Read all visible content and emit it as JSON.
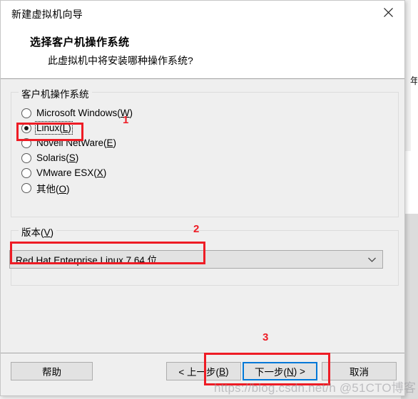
{
  "window": {
    "title": "新建虚拟机向导",
    "close_icon": "close-icon"
  },
  "header": {
    "title": "选择客户机操作系统",
    "subtitle": "此虚拟机中将安装哪种操作系统?"
  },
  "guest_os_group": {
    "legend_prefix": "客户机操作系统",
    "options": [
      {
        "label": "Microsoft Windows(W)",
        "text": "Microsoft Windows(",
        "accel": "W",
        "suffix": ")",
        "selected": false
      },
      {
        "label": "Linux(L)",
        "text": "Linux(",
        "accel": "L",
        "suffix": ")",
        "selected": true
      },
      {
        "label": "Novell NetWare(E)",
        "text": "Novell NetWare(",
        "accel": "E",
        "suffix": ")",
        "selected": false
      },
      {
        "label": "Solaris(S)",
        "text": "Solaris(",
        "accel": "S",
        "suffix": ")",
        "selected": false
      },
      {
        "label": "VMware ESX(X)",
        "text": "VMware ESX(",
        "accel": "X",
        "suffix": ")",
        "selected": false
      },
      {
        "label": "其他(O)",
        "text": "其他(",
        "accel": "O",
        "suffix": ")",
        "selected": false
      }
    ]
  },
  "version_group": {
    "legend_text": "版本(",
    "legend_accel": "V",
    "legend_suffix": ")",
    "selected_value": "Red Hat Enterprise Linux 7 64 位",
    "arrow_icon": "chevron-down-icon"
  },
  "footer": {
    "help": "帮助",
    "back_prefix": "< 上一步(",
    "back_accel": "B",
    "back_suffix": ")",
    "next_prefix": "下一步(",
    "next_accel": "N",
    "next_suffix": ") >",
    "cancel": "取消"
  },
  "annotations": {
    "num1": "1",
    "num2": "2",
    "num3": "3"
  },
  "watermark": {
    "text": "https://blog.csdn.net/h @51CTO博客"
  },
  "background": {
    "clipped_text": "年"
  },
  "colors": {
    "annotation_red": "#ee1c25",
    "focus_blue": "#0078d7",
    "dialog_bg": "#efefef",
    "header_bg": "#ffffff"
  }
}
